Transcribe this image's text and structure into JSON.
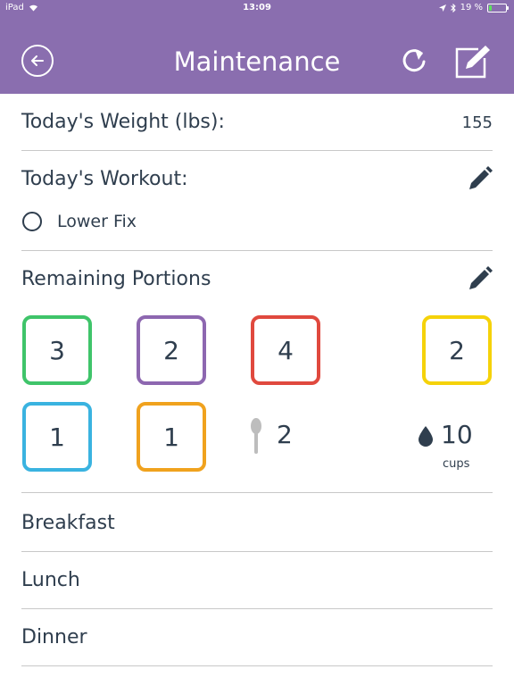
{
  "status_bar": {
    "device": "iPad",
    "time": "13:09",
    "battery": "19 %",
    "battery_level": 0.19
  },
  "header": {
    "title": "Maintenance",
    "background_color": "#8a6eaf",
    "back_icon": "back-arrow-icon",
    "refresh_icon": "refresh-icon",
    "edit_icon": "edit-note-icon"
  },
  "weight": {
    "label": "Today's Weight (lbs):",
    "value": "155"
  },
  "workout": {
    "label": "Today's Workout:",
    "item": "Lower Fix",
    "edit_icon": "pencil-icon"
  },
  "portions": {
    "label": "Remaining Portions",
    "edit_icon": "pencil-icon",
    "containers": [
      {
        "value": "3",
        "color": "#3fc46a"
      },
      {
        "value": "2",
        "color": "#8d67b0"
      },
      {
        "value": "4",
        "color": "#e0493e"
      },
      {
        "value": "2",
        "color": "#f5d20a"
      },
      {
        "value": "1",
        "color": "#3ab3e0"
      },
      {
        "value": "1",
        "color": "#f0a21e"
      }
    ],
    "teaspoons": {
      "value": "2",
      "icon": "spoon-icon"
    },
    "water": {
      "value": "10",
      "unit": "cups",
      "icon": "water-drop-icon"
    }
  },
  "meals": [
    {
      "label": "Breakfast"
    },
    {
      "label": "Lunch"
    },
    {
      "label": "Dinner"
    }
  ]
}
